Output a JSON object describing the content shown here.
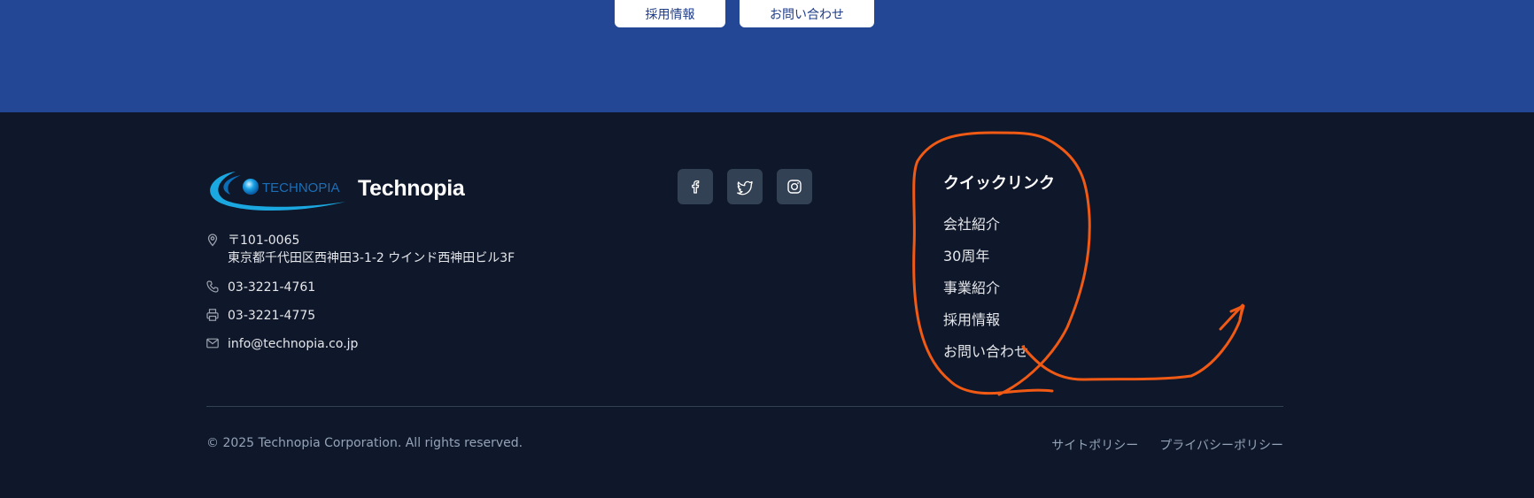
{
  "cta": {
    "careers_label": "採用情報",
    "contact_label": "お問い合わせ"
  },
  "brand": {
    "logo_text": "TECHNOPIA",
    "name": "Technopia"
  },
  "contact": {
    "postal_code": "〒101-0065",
    "address": "東京都千代田区西神田3-1-2 ウインド西神田ビル3F",
    "phone": "03-3221-4761",
    "fax": "03-3221-4775",
    "email": "info@technopia.co.jp"
  },
  "social": [
    "facebook-icon",
    "twitter-icon",
    "instagram-icon"
  ],
  "quick_links": {
    "title": "クイックリンク",
    "items": [
      "会社紹介",
      "30周年",
      "事業紹介",
      "採用情報",
      "お問い合わせ"
    ]
  },
  "footer_bottom": {
    "copyright": "© 2025 Technopia Corporation. All rights reserved.",
    "site_policy": "サイトポリシー",
    "privacy_policy": "プライバシーポリシー"
  },
  "colors": {
    "top_band": "#234795",
    "footer_bg": "#0f172a",
    "annotation": "#f05a14"
  }
}
